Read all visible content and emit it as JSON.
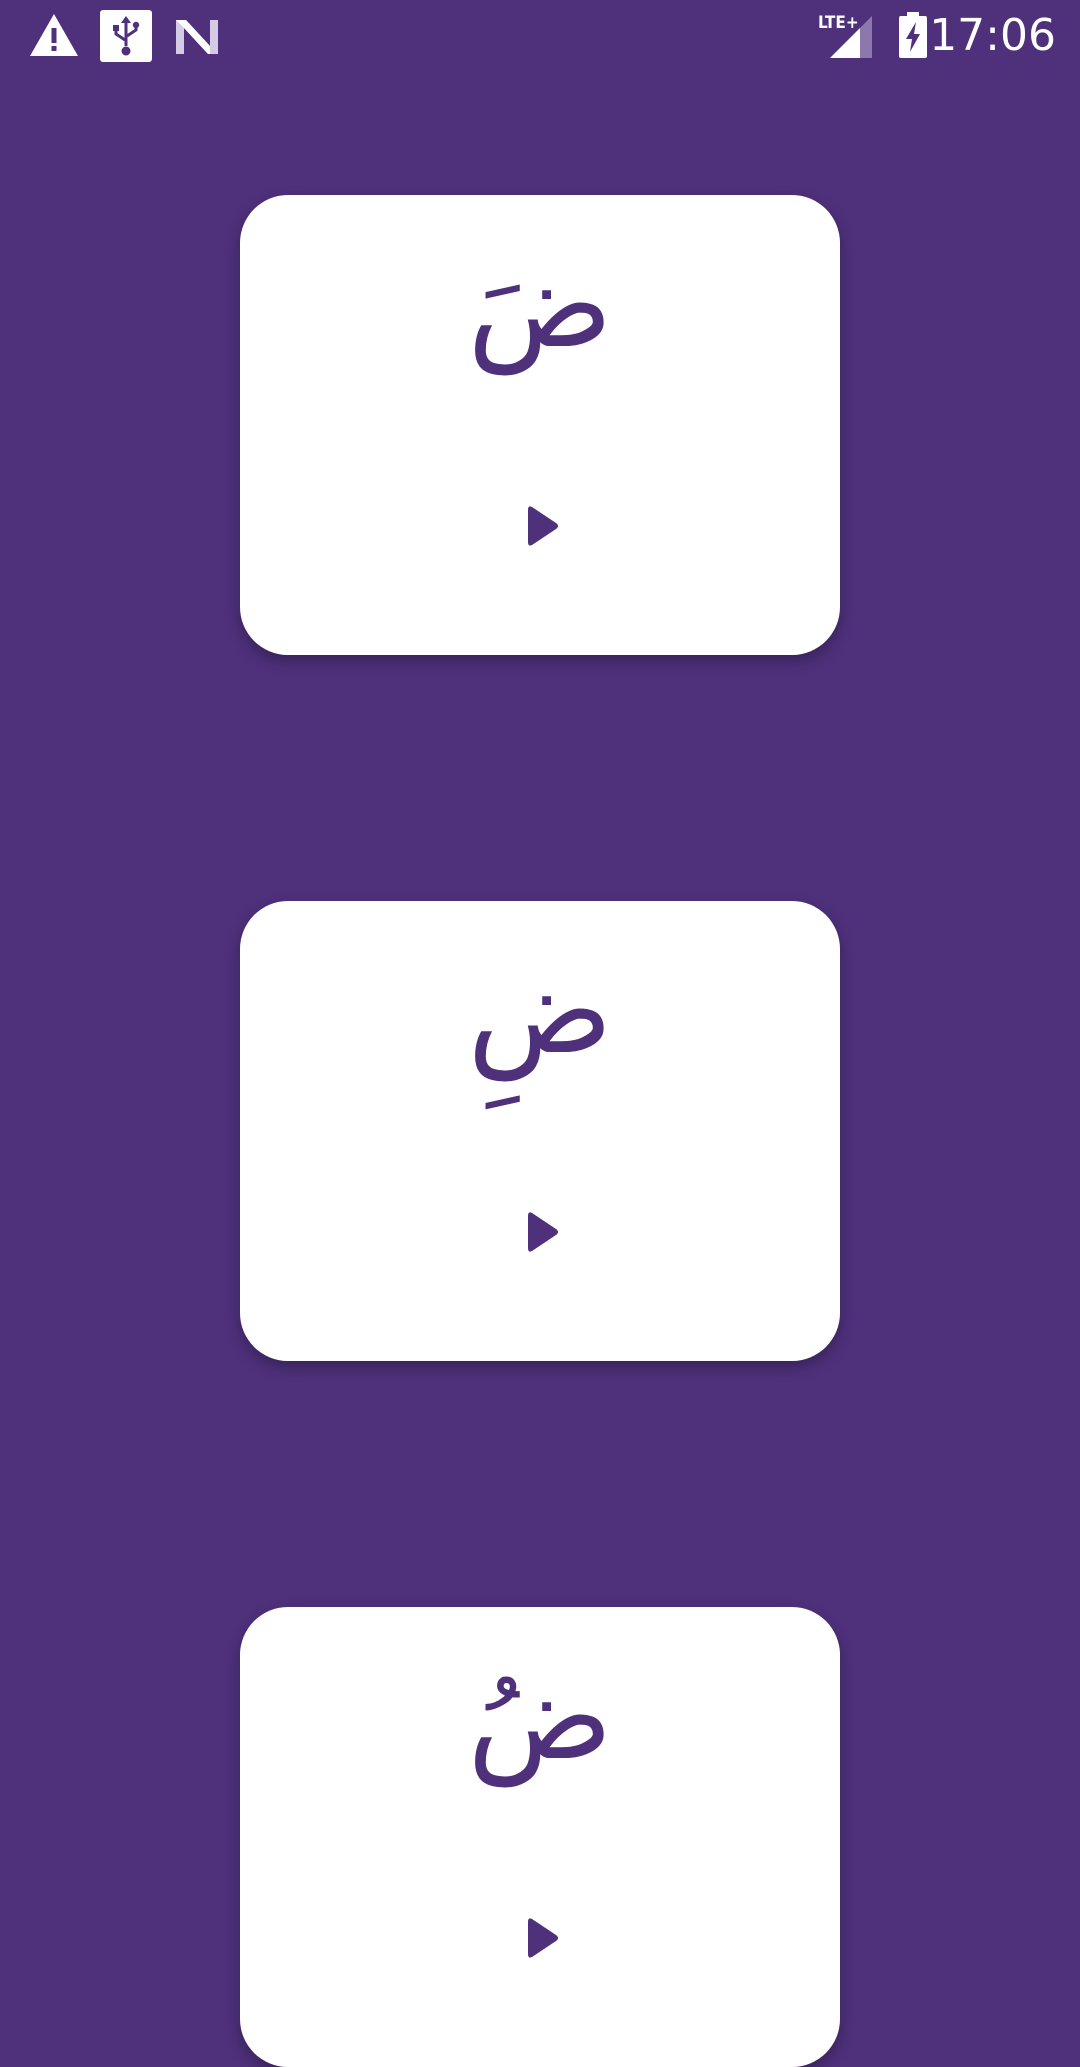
{
  "status_bar": {
    "time": "17:06",
    "network_label": "LTE+",
    "icons": [
      "warning-icon",
      "usb-icon",
      "n-logo-icon",
      "signal-icon",
      "battery-charging-icon"
    ]
  },
  "cards": [
    {
      "letter": "ضَ",
      "action_icon": "play-icon"
    },
    {
      "letter": "ضِ",
      "action_icon": "play-icon"
    },
    {
      "letter": "ضُ",
      "action_icon": "play-icon"
    }
  ],
  "colors": {
    "background": "#4e307b",
    "card": "#ffffff",
    "accent": "#4e307b"
  }
}
